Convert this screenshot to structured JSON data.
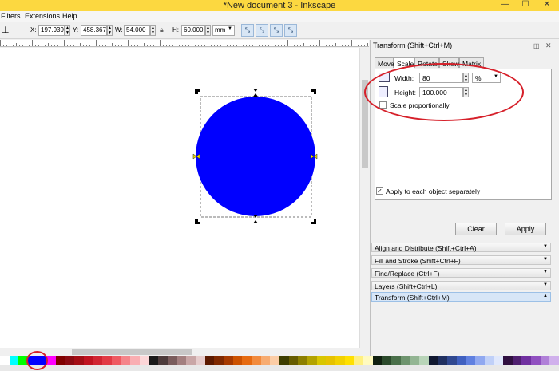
{
  "window": {
    "title": "*New document 3 - Inkscape",
    "buttons": {
      "minimize": "—",
      "maximize": "☐",
      "close": "✕"
    }
  },
  "menu": {
    "items": [
      "Filters",
      "Extensions",
      "Help"
    ]
  },
  "toolbar": {
    "x_label": "X:",
    "x_value": "197.939",
    "y_label": "Y:",
    "y_value": "458.367",
    "w_label": "W:",
    "w_value": "54.000",
    "lock_icon": "lock-icon",
    "h_label": "H:",
    "h_value": "60.000",
    "unit": "mm"
  },
  "canvas": {
    "shape_color": "#0000ff",
    "shape": "circle"
  },
  "transform_panel": {
    "title": "Transform (Shift+Ctrl+M)",
    "tabs": [
      "Move",
      "Scale",
      "Rotate",
      "Skew",
      "Matrix"
    ],
    "active_tab": "Scale",
    "width_label": "Width:",
    "width_value": "80",
    "unit_value": "%",
    "height_label": "Height:",
    "height_value": "100.000",
    "scale_proportionally_label": "Scale proportionally",
    "apply_each_label": "Apply to each object separately",
    "clear_label": "Clear",
    "apply_label": "Apply"
  },
  "dock_items": [
    "Align and Distribute (Shift+Ctrl+A)",
    "Fill and Stroke (Shift+Ctrl+F)",
    "Find/Replace (Ctrl+F)",
    "Layers (Shift+Ctrl+L)",
    "Transform (Shift+Ctrl+M)"
  ],
  "palette": {
    "colors": [
      "#ffffff",
      "#00ffff",
      "#00ff00",
      "#0000ff",
      "#0000ff",
      "#ff00ff",
      "#800000",
      "#8b0a12",
      "#a30d15",
      "#c01320",
      "#d12532",
      "#e23a45",
      "#ef5a62",
      "#f5848a",
      "#f9aeb2",
      "#fcd6d8",
      "#1a1a1a",
      "#4d3b3b",
      "#7a5c5c",
      "#a37f7f",
      "#c9a6a6",
      "#e6cccc",
      "#5c1a00",
      "#7f2900",
      "#a63a00",
      "#cc5200",
      "#e66a10",
      "#f28a3c",
      "#f7ab70",
      "#fbcca5",
      "#3d3d00",
      "#665c00",
      "#8c7f00",
      "#b3a300",
      "#d9c600",
      "#e6c200",
      "#f2d100",
      "#ffe000",
      "#fff080",
      "#fffac0",
      "#102010",
      "#2b4a2b",
      "#4a704a",
      "#6e946e",
      "#93b593",
      "#b8d4b8",
      "#101830",
      "#203060",
      "#304890",
      "#4060c0",
      "#6080e0",
      "#90a8f0",
      "#c0d0f8",
      "#e0e8fc",
      "#301040",
      "#502070",
      "#7030a0",
      "#9050c0",
      "#b080d8",
      "#d0b0ec"
    ]
  }
}
